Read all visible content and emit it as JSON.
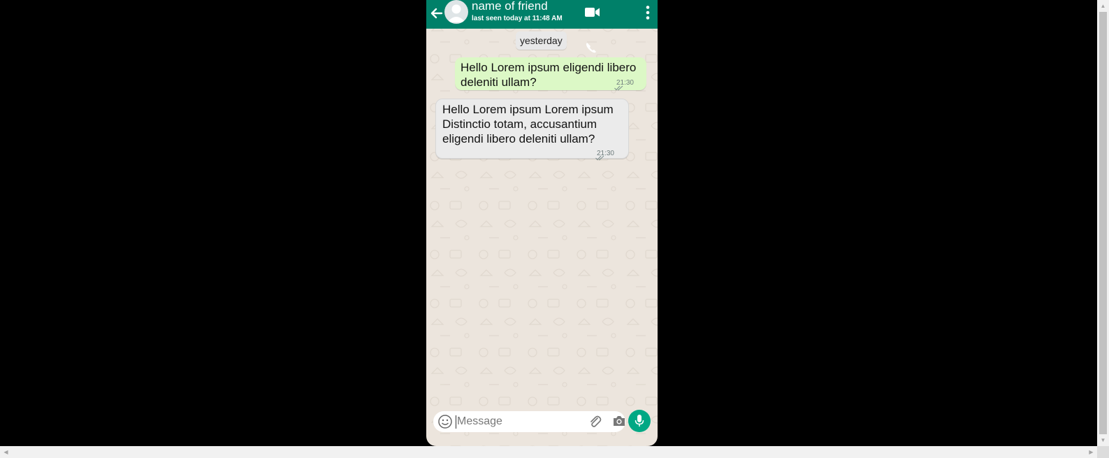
{
  "header": {
    "contact_name": "name of friend",
    "last_seen": "last seen today at 11:48 AM",
    "icons": [
      "back-arrow-icon",
      "avatar-icon",
      "video-call-icon",
      "more-vert-icon"
    ]
  },
  "chat": {
    "date_label": "yesterday",
    "messages": [
      {
        "direction": "outgoing",
        "text": "Hello Lorem ipsum eligendi libero deleniti ullam?",
        "time": "21:30",
        "status": "double-check"
      },
      {
        "direction": "incoming",
        "text": "Hello Lorem ipsum Lorem ipsum Distinctio totam, accusantium eligendi libero deleniti ullam?",
        "time": "21:30",
        "status": "double-check"
      }
    ]
  },
  "composer": {
    "placeholder": "Message",
    "value": "",
    "icons": [
      "emoji-icon",
      "attach-icon",
      "camera-icon",
      "mic-icon"
    ]
  },
  "colors": {
    "header": "#008069",
    "chat_background": "#ece5dd",
    "outgoing_bubble": "#dcf8c6",
    "incoming_bubble": "#ebebeb",
    "mic_button": "#00a884"
  }
}
